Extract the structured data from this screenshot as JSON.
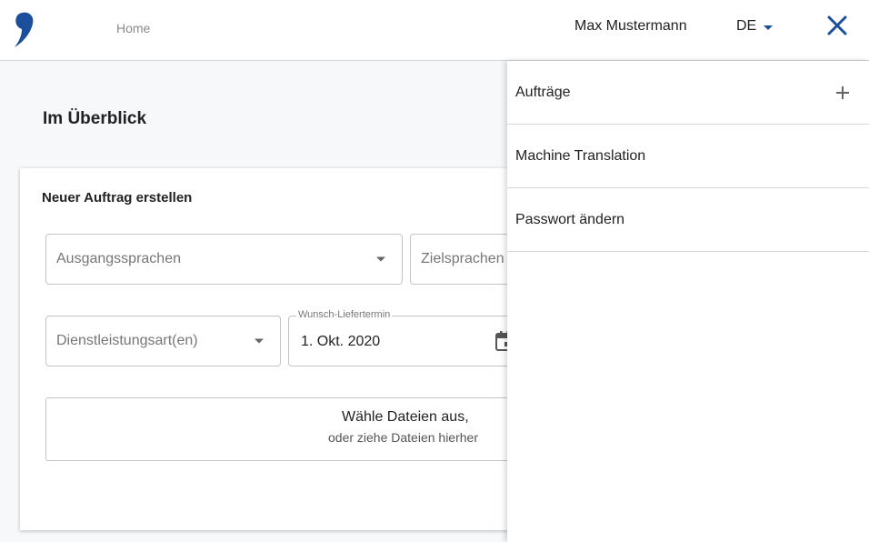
{
  "header": {
    "nav_home": "Home",
    "user_name": "Max Mustermann",
    "language": "DE",
    "logo_icon": "brand-comma-logo-icon",
    "close_icon": "close-icon",
    "brand_color": "#1b4f9c"
  },
  "main": {
    "title": "Im Überblick",
    "card": {
      "title": "Neuer Auftrag erstellen",
      "source_languages_placeholder": "Ausgangssprachen",
      "target_languages_placeholder": "Zielsprachen",
      "service_type_placeholder": "Dienstleistungsart(en)",
      "delivery_date_label": "Wunsch-Liefertermin",
      "delivery_date_value": "1. Okt. 2020",
      "calendar_icon": "calendar-icon",
      "dropzone_line1": "Wähle Dateien aus,",
      "dropzone_line2": "oder ziehe Dateien hierher"
    }
  },
  "drawer": {
    "items": [
      {
        "label": "Aufträge",
        "icon": "plus-icon"
      },
      {
        "label": "Machine Translation"
      },
      {
        "label": "Passwort ändern"
      }
    ]
  }
}
